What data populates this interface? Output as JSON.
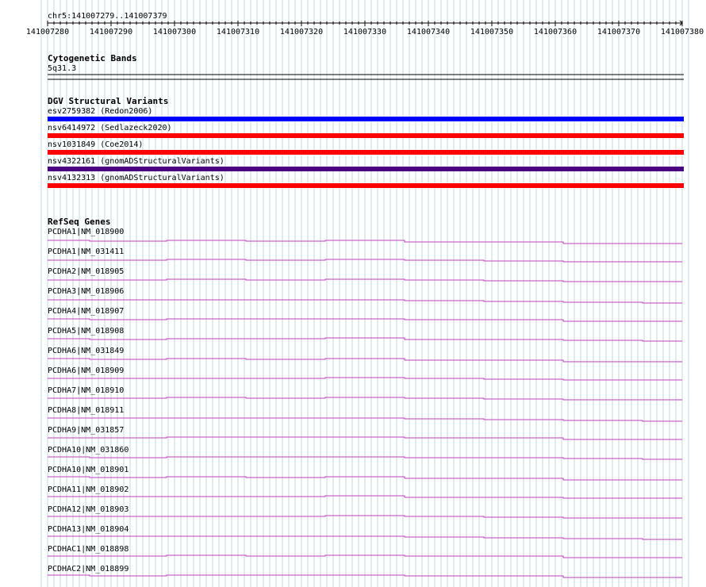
{
  "locus": "chr5:141007279..141007379",
  "ruler": {
    "start": 141007280,
    "end": 141007380,
    "tick_labels": [
      "141007280",
      "141007290",
      "141007300",
      "141007310",
      "141007320",
      "141007330",
      "141007340",
      "141007350",
      "141007360",
      "141007370",
      "141007380"
    ]
  },
  "tracks": {
    "cytogenetic": {
      "title": "Cytogenetic Bands",
      "band": "5q31.3"
    },
    "dgv": {
      "title": "DGV Structural Variants",
      "items": [
        {
          "label": "esv2759382 (Redon2006)",
          "color": "#0000ff"
        },
        {
          "label": "nsv6414972 (Sedlazeck2020)",
          "color": "#ff0000"
        },
        {
          "label": "nsv1031849 (Coe2014)",
          "color": "#ff0000"
        },
        {
          "label": "nsv4322161 (gnomADStructuralVariants)",
          "color": "#4b0082"
        },
        {
          "label": "nsv4132313 (gnomADStructuralVariants)",
          "color": "#ff0000"
        }
      ]
    },
    "refseq": {
      "title": "RefSeq Genes",
      "color": "#c040c0",
      "items": [
        "PCDHA1|NM_018900",
        "PCDHA1|NM_031411",
        "PCDHA2|NM_018905",
        "PCDHA3|NM_018906",
        "PCDHA4|NM_018907",
        "PCDHA5|NM_018908",
        "PCDHA6|NM_031849",
        "PCDHA6|NM_018909",
        "PCDHA7|NM_018910",
        "PCDHA8|NM_018911",
        "PCDHA9|NM_031857",
        "PCDHA10|NM_031860",
        "PCDHA10|NM_018901",
        "PCDHA11|NM_018902",
        "PCDHA12|NM_018903",
        "PCDHA13|NM_018904",
        "PCDHAC1|NM_018898",
        "PCDHAC2|NM_018899"
      ]
    }
  },
  "colors": {
    "grid": "#b8dce6",
    "axis": "#000000"
  }
}
